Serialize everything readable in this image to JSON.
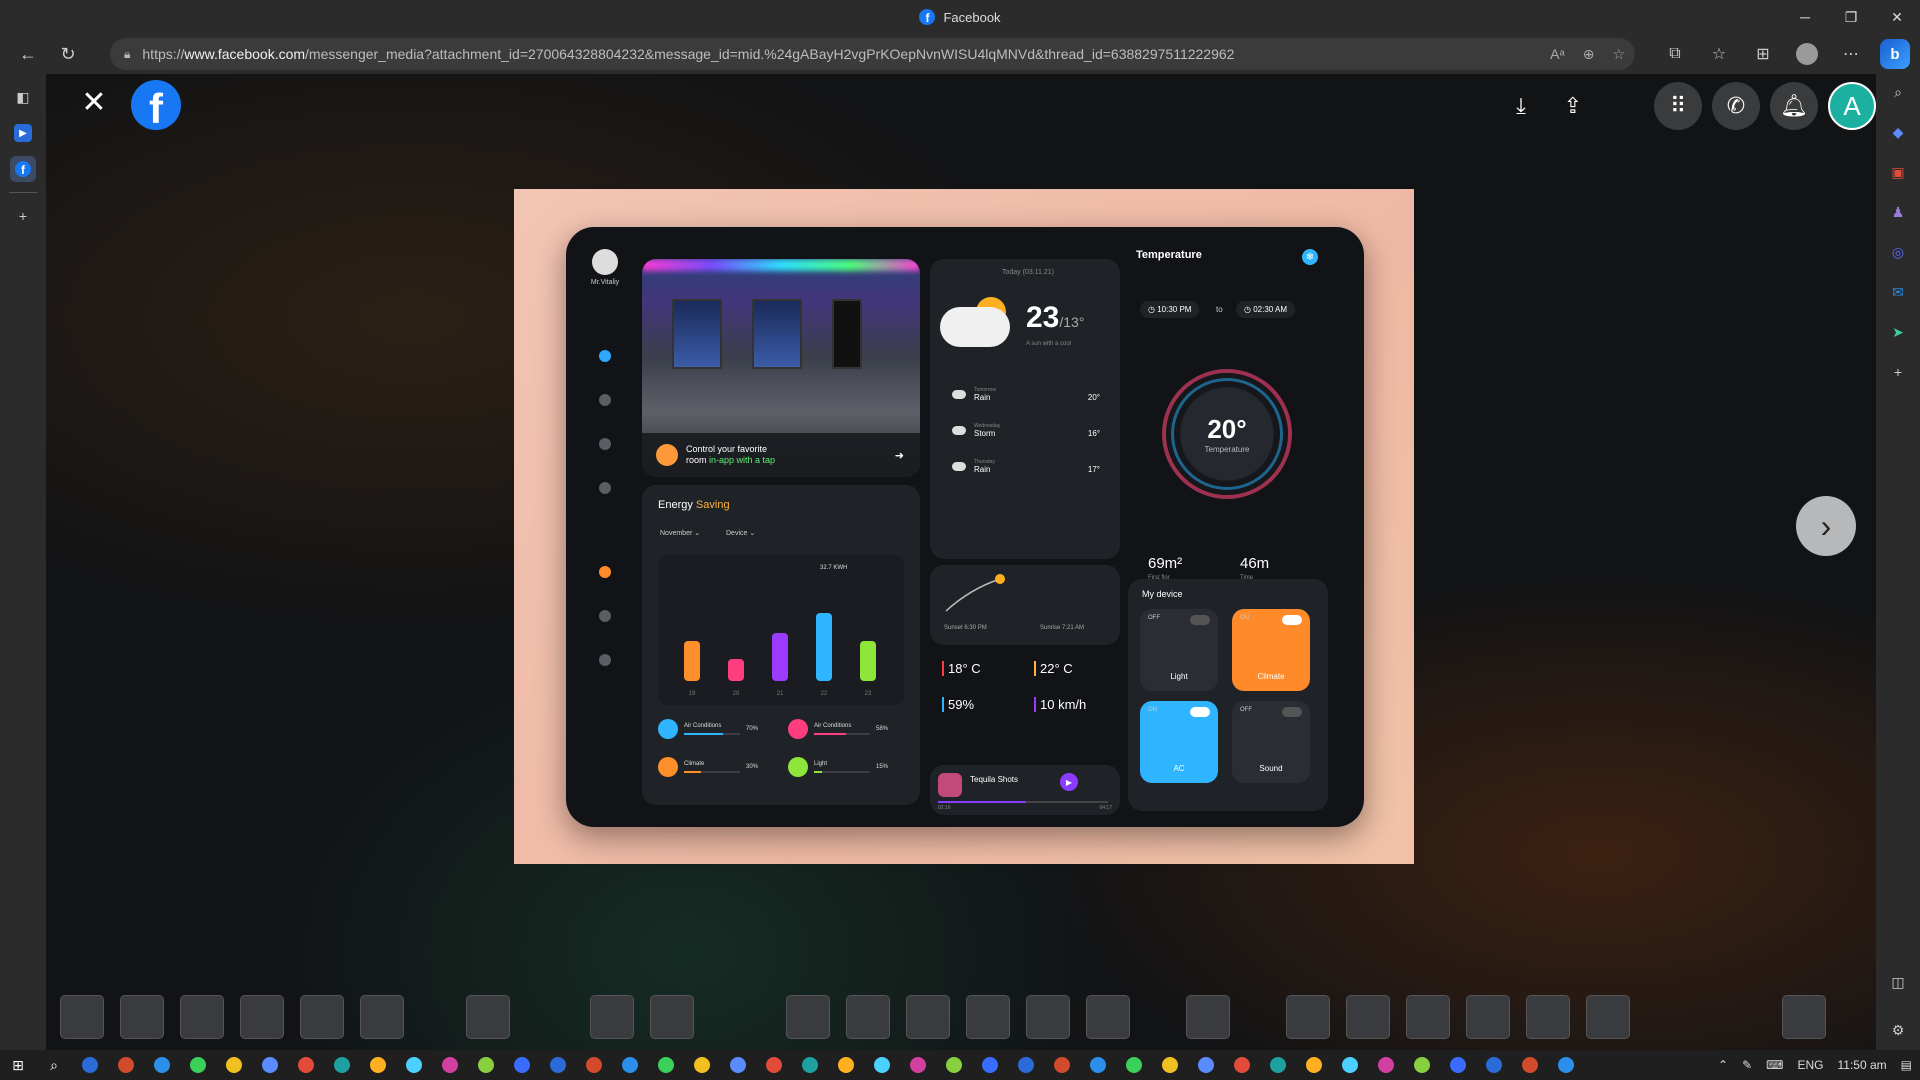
{
  "window": {
    "title": "Facebook",
    "controls": {
      "minimize": "─",
      "restore": "❐",
      "close": "✕"
    }
  },
  "browser": {
    "url_prefix": "https://",
    "url_domain": "www.facebook.com",
    "url_path": "/messenger_media?attachment_id=270064328804232&message_id=mid.%24gABayH2vgPrKOepNvnWISU4lqMNVd&thread_id=6388297511222962",
    "icons": [
      "read-aloud-icon",
      "zoom-icon",
      "favorite-add-icon",
      "extensions-icon",
      "favorites-icon",
      "collections-icon",
      "profile-icon",
      "more-icon",
      "bing-icon"
    ],
    "bing_label": "b"
  },
  "viewer": {
    "close_label": "✕",
    "fb_logo_letter": "f",
    "top_icons": [
      "download-icon",
      "share-icon",
      "menu-grid-icon",
      "messenger-icon",
      "notifications-icon"
    ],
    "avatar_letter": "A",
    "next_label": "›"
  },
  "image": {
    "user_name": "Mr.Vitaliy",
    "room": {
      "title_1": "Control your favorite",
      "title_2_prefix": "room ",
      "title_2_highlight": "in-app with a tap",
      "arrow": "➜"
    },
    "energy": {
      "title_prefix": "Energy ",
      "title_highlight": "Saving",
      "month": "November ⌄",
      "device": "Device ⌄",
      "peak_label": "32.7 KWH",
      "bars": [
        {
          "label": "19",
          "value": 40,
          "color": "#ff8f2a"
        },
        {
          "label": "20",
          "value": 22,
          "color": "#ff3e7f"
        },
        {
          "label": "21",
          "value": 48,
          "color": "#9a3bff"
        },
        {
          "label": "22",
          "value": 68,
          "color": "#2fb4ff"
        },
        {
          "label": "23",
          "value": 40,
          "color": "#8ee63a"
        }
      ],
      "controls": [
        {
          "label": "Air Conditions",
          "pct": "70%",
          "color": "#2fb4ff"
        },
        {
          "label": "Air Conditions",
          "pct": "58%",
          "color": "#ff3e7f"
        },
        {
          "label": "Climate",
          "pct": "30%",
          "color": "#ff8f2a"
        },
        {
          "label": "Light",
          "pct": "15%",
          "color": "#8ee63a"
        }
      ]
    },
    "weather": {
      "date": "Today (03.11.21)",
      "temp": "23",
      "temp_low": "/13°",
      "desc": "A sun with a cool",
      "forecast": [
        {
          "day": "Tomorrow",
          "cond": "Rain",
          "temp": "20°"
        },
        {
          "day": "Wednesday",
          "cond": "Storm",
          "temp": "16°"
        },
        {
          "day": "Thursday",
          "cond": "Rain",
          "temp": "17°"
        }
      ],
      "sunset": "Sunset 6:30 PM",
      "sunrise": "Sunrise 7:21 AM"
    },
    "stats": [
      {
        "value": "18° C",
        "color": "#ff3b3b"
      },
      {
        "value": "22° C",
        "color": "#ffb23e"
      },
      {
        "value": "59%",
        "color": "#2fb4ff"
      },
      {
        "value": "10 km/h",
        "color": "#9a3bff"
      }
    ],
    "music": {
      "title": "Tequila Shots",
      "time_start": "02:16",
      "time_end": "04:17"
    },
    "temperature": {
      "title": "Temperature",
      "from": "◷ 10:30 PM",
      "to_label": "to",
      "to": "◷ 02:30 AM",
      "value": "20°",
      "label": "Temperature",
      "area": "69m²",
      "area_label": "First flor",
      "time": "46m",
      "time_label": "Time"
    },
    "devices": {
      "title": "My device",
      "cards": [
        {
          "state": "OFF",
          "name": "Light",
          "bg": "#2a2d33"
        },
        {
          "state": "ON",
          "name": "Climate",
          "bg": "#ff8a2a"
        },
        {
          "state": "ON",
          "name": "AC",
          "bg": "#2fb4ff"
        },
        {
          "state": "OFF",
          "name": "Sound",
          "bg": "#2a2d33"
        }
      ]
    }
  },
  "taskbar": {
    "tray_lang": "ENG",
    "time": "11:50 am"
  }
}
